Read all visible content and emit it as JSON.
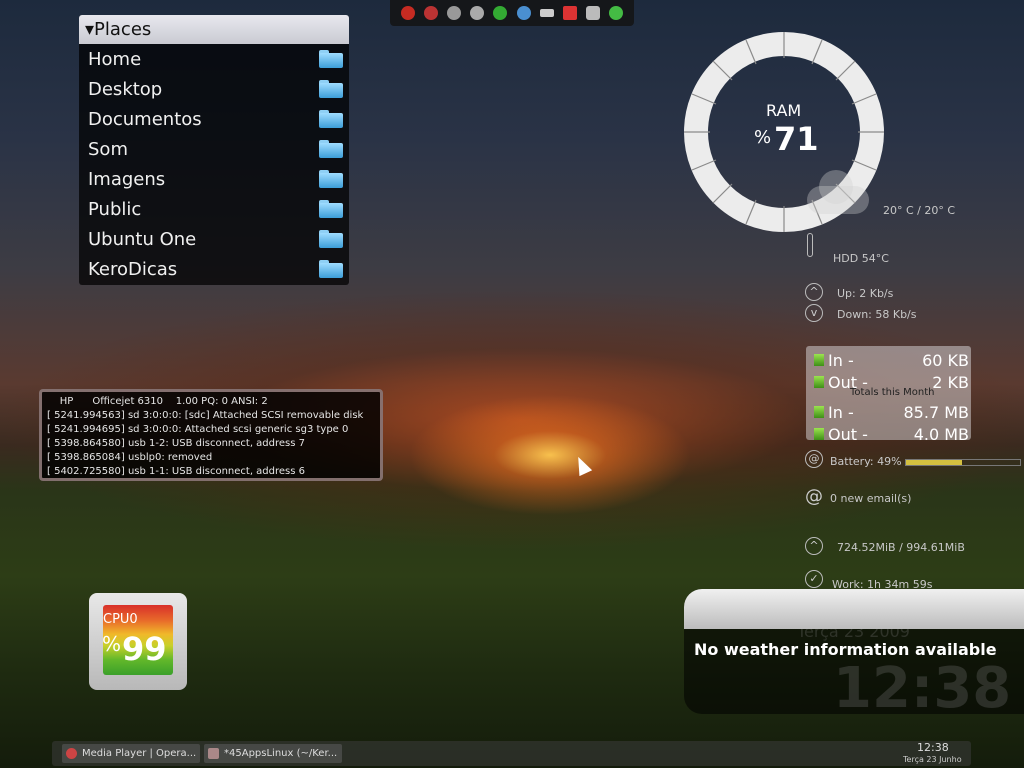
{
  "places": {
    "header": "Places",
    "items": [
      "Home",
      "Desktop",
      "Documentos",
      "Som",
      "Imagens",
      "Public",
      "Ubuntu One",
      "KeroDicas"
    ]
  },
  "ram": {
    "label": "RAM",
    "percent_sign": "%",
    "value": "71"
  },
  "weather_temp": "20° C / 20° C",
  "hdd": "HDD 54°C",
  "net_up": "Up: 2 Kb/s",
  "net_down": "Down: 58 Kb/s",
  "netbox": {
    "in1_label": "In -",
    "in1_val": "60 KB",
    "out1_label": "Out -",
    "out1_val": "2 KB",
    "totals": "Totals this Month",
    "in2_label": "In -",
    "in2_val": "85.7 MB",
    "out2_label": "Out -",
    "out2_val": "4.0 MB"
  },
  "battery": "Battery: 49%",
  "email": "0 new email(s)",
  "memory": "724.52MiB / 994.61MiB",
  "work": "Work:  1h 34m 59s",
  "log_lines": [
    "    HP      Officejet 6310    1.00 PQ: 0 ANSI: 2",
    "[ 5241.994563] sd 3:0:0:0: [sdc] Attached SCSI removable disk",
    "[ 5241.994695] sd 3:0:0:0: Attached scsi generic sg3 type 0",
    "[ 5398.864580] usb 1-2: USB disconnect, address 7",
    "[ 5398.865084] usblp0: removed",
    "[ 5402.725580] usb 1-1: USB disconnect, address 6"
  ],
  "cpu": {
    "label": "CPU0",
    "percent_sign": "%",
    "value": "99"
  },
  "weather_msg": "No weather information available",
  "clock_ghost": "12:38",
  "date_ghost": "Terça 23 2009",
  "taskbar": {
    "task1": "Media Player | Opera...",
    "task2": "*45AppsLinux (~/Ker...",
    "time": "12:38",
    "date": "Terça 23 Junho"
  },
  "colors": {
    "battery_bar": "#d4c040",
    "accent": "#3c9ed8"
  }
}
